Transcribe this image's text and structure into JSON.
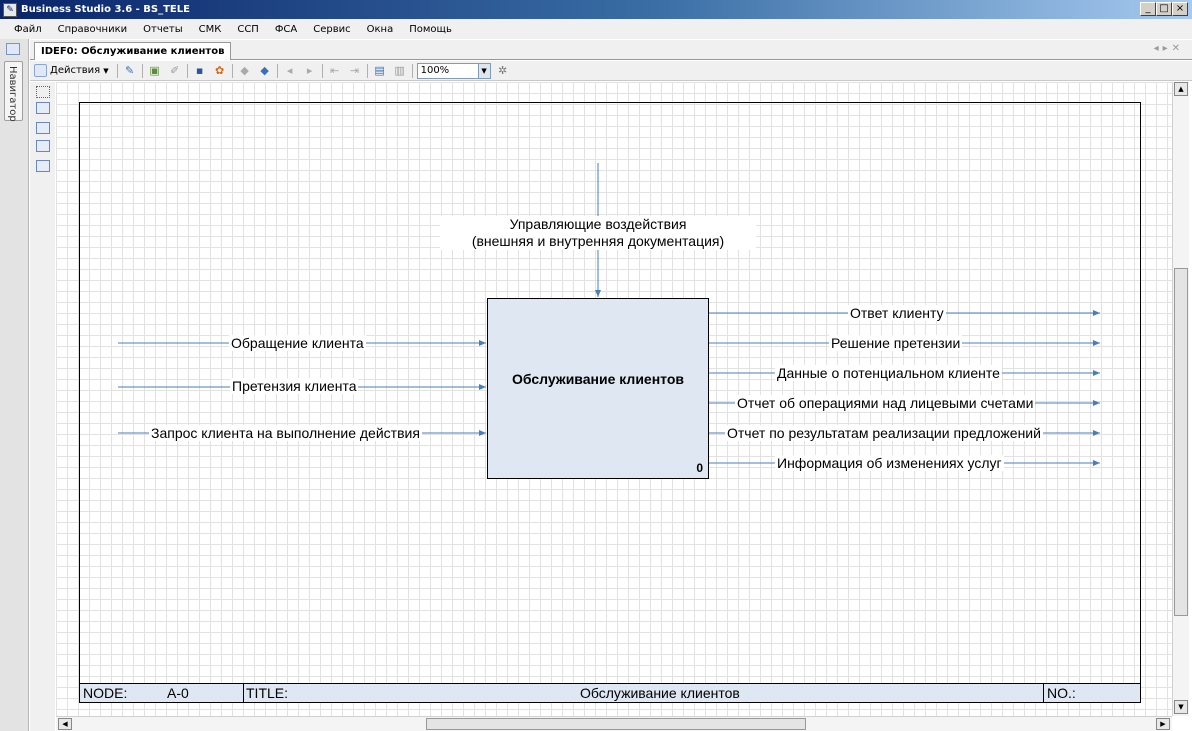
{
  "window": {
    "title": "Business Studio 3.6 - BS_TELE",
    "controls": [
      "_",
      "□",
      "×"
    ]
  },
  "menu": [
    "Файл",
    "Справочники",
    "Отчеты",
    "СМК",
    "ССП",
    "ФСА",
    "Сервис",
    "Окна",
    "Помощь"
  ],
  "navigator": {
    "label": "Навигатор"
  },
  "document_tab": {
    "label": "IDEF0: Обслуживание клиентов"
  },
  "toolbar": {
    "actions_label": "Действия",
    "zoom_value": "100%"
  },
  "diagram": {
    "function": {
      "title": "Обслуживание клиентов",
      "number": "0"
    },
    "control": {
      "line1": "Управляющие воздействия",
      "line2": "(внешняя и внутренняя документация)"
    },
    "inputs": [
      "Обращение клиента",
      "Претензия клиента",
      "Запрос клиента на выполнение действия"
    ],
    "outputs": [
      "Ответ клиенту",
      "Решение претензии",
      "Данные о потенциальном клиенте",
      "Отчет об операциями над лицевыми счетами",
      "Отчет по результатам реализации предложений",
      "Информация об изменениях услуг"
    ],
    "line_color": "#4a7ebb"
  },
  "footer": {
    "node_label": "NODE:",
    "node_value": "A-0",
    "title_label": "TITLE:",
    "title_value": "Обслуживание клиентов",
    "no_label": "NO.:"
  }
}
